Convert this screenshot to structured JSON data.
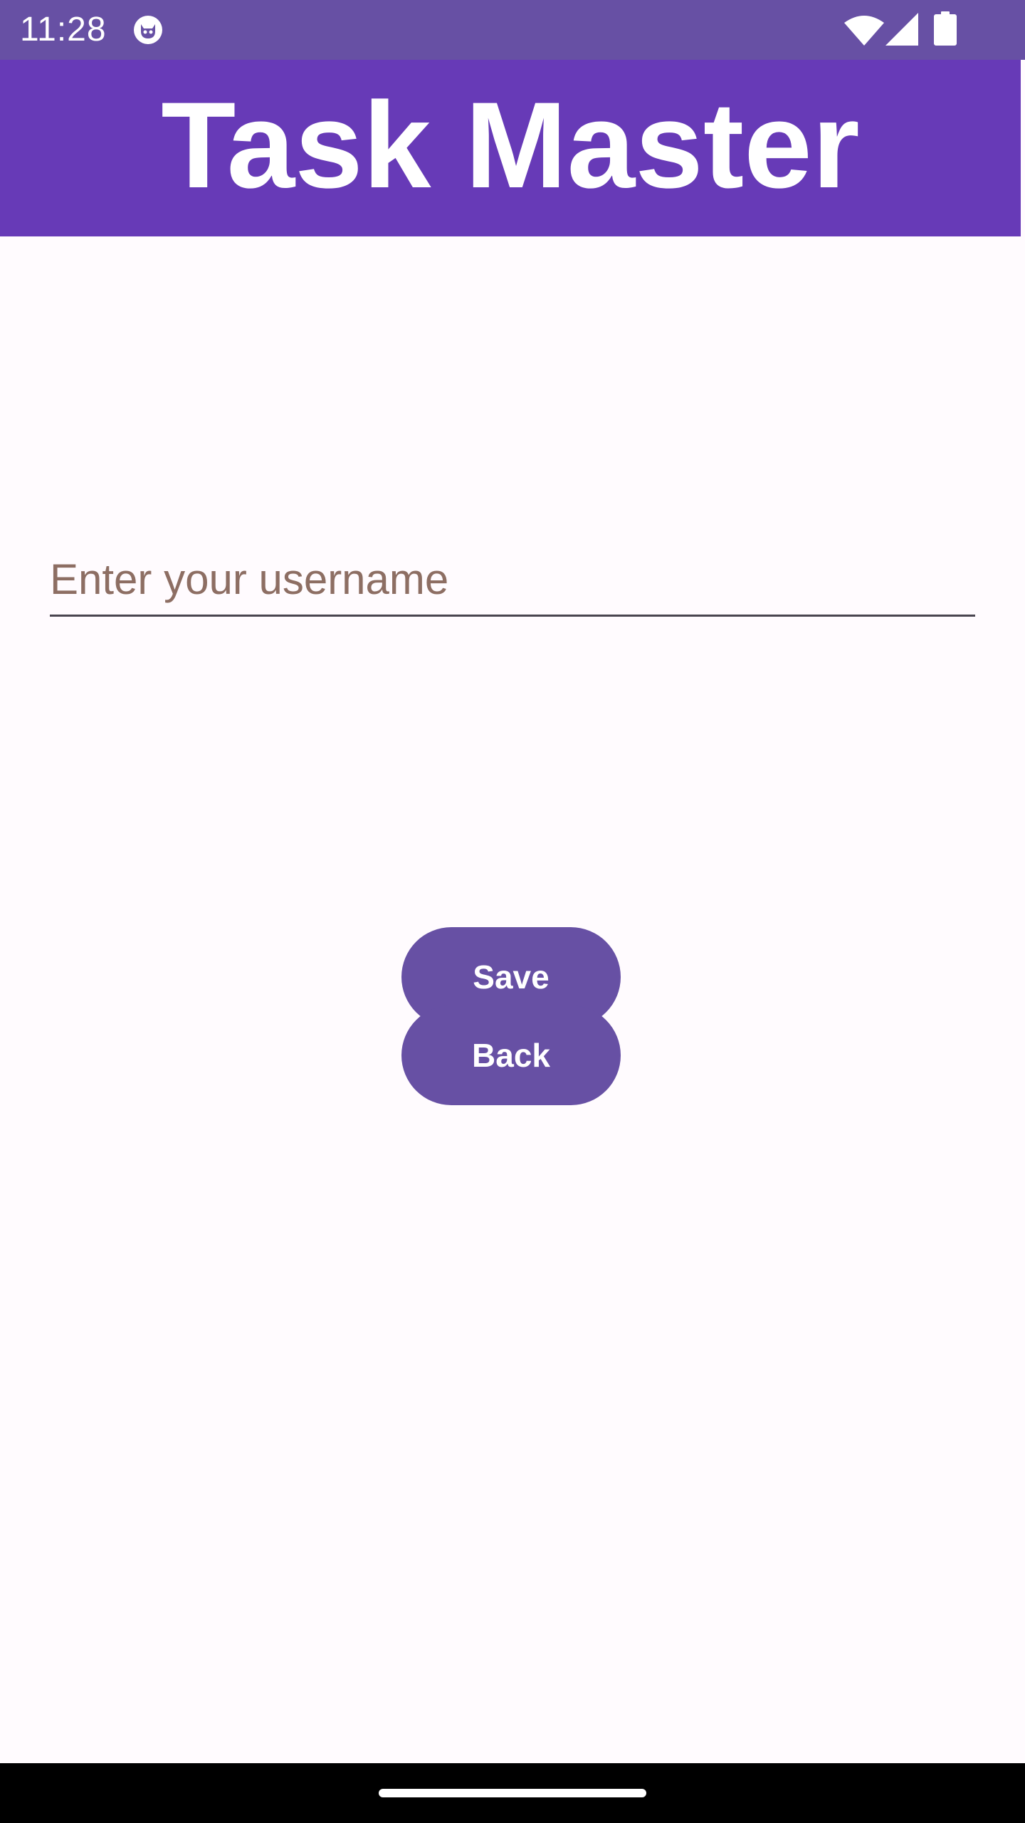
{
  "status_bar": {
    "time": "11:28",
    "background": "#6750a4",
    "icons": [
      "app-notification-icon",
      "wifi-icon",
      "signal-icon",
      "battery-icon"
    ]
  },
  "app_bar": {
    "title": "Task Master",
    "background": "#673ab7"
  },
  "form": {
    "username_placeholder": "Enter your username",
    "username_value": ""
  },
  "buttons": {
    "save_label": "Save",
    "back_label": "Back",
    "color": "#6750a4"
  },
  "nav_bar": {
    "background": "#000000"
  }
}
